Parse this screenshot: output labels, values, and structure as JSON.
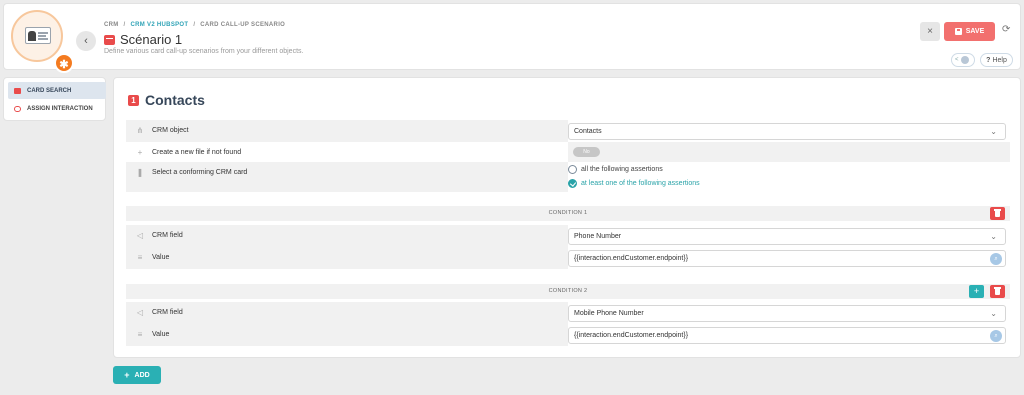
{
  "breadcrumb": {
    "items": [
      "CRM",
      "CRM V2 HUBSPOT",
      "CARD CALL-UP SCENARIO"
    ],
    "separator": "/"
  },
  "header": {
    "title": "Scénario 1",
    "subtitle": "Define various card call-up scenarios from your different objects.",
    "save_label": "SAVE",
    "close_icon": "×",
    "refresh_icon": "⟳",
    "back_icon": "‹",
    "help_label": "Help",
    "help_icon": "?",
    "toggle_label": "<"
  },
  "sidebar": {
    "items": [
      {
        "label": "CARD SEARCH",
        "active": true,
        "icon": "card-search-icon"
      },
      {
        "label": "ASSIGN INTERACTION",
        "active": false,
        "icon": "link-icon"
      }
    ]
  },
  "section": {
    "number": "1",
    "title": "Contacts",
    "crm_object_label": "CRM object",
    "crm_object_value": "Contacts",
    "create_file_label": "Create a new file if not found",
    "create_file_toggle": "No",
    "conforming_label": "Select a conforming CRM card",
    "assertion_options": [
      "all the following assertions",
      "at least one of the following assertions"
    ],
    "assertion_selected": 1
  },
  "conditions": [
    {
      "title": "CONDITION 1",
      "crm_field_label": "CRM field",
      "crm_field_value": "Phone Number",
      "value_label": "Value",
      "value_value": "{{interaction.endCustomer.endpoint}}"
    },
    {
      "title": "CONDITION 2",
      "crm_field_label": "CRM field",
      "crm_field_value": "Mobile Phone Number",
      "value_label": "Value",
      "value_value": "{{interaction.endCustomer.endpoint}}"
    }
  ],
  "add_button_label": "ADD",
  "colors": {
    "accent_red": "#e94b4b",
    "save_red": "#f2706e",
    "teal": "#2ab0b4",
    "hubspot_orange": "#f47b20"
  }
}
